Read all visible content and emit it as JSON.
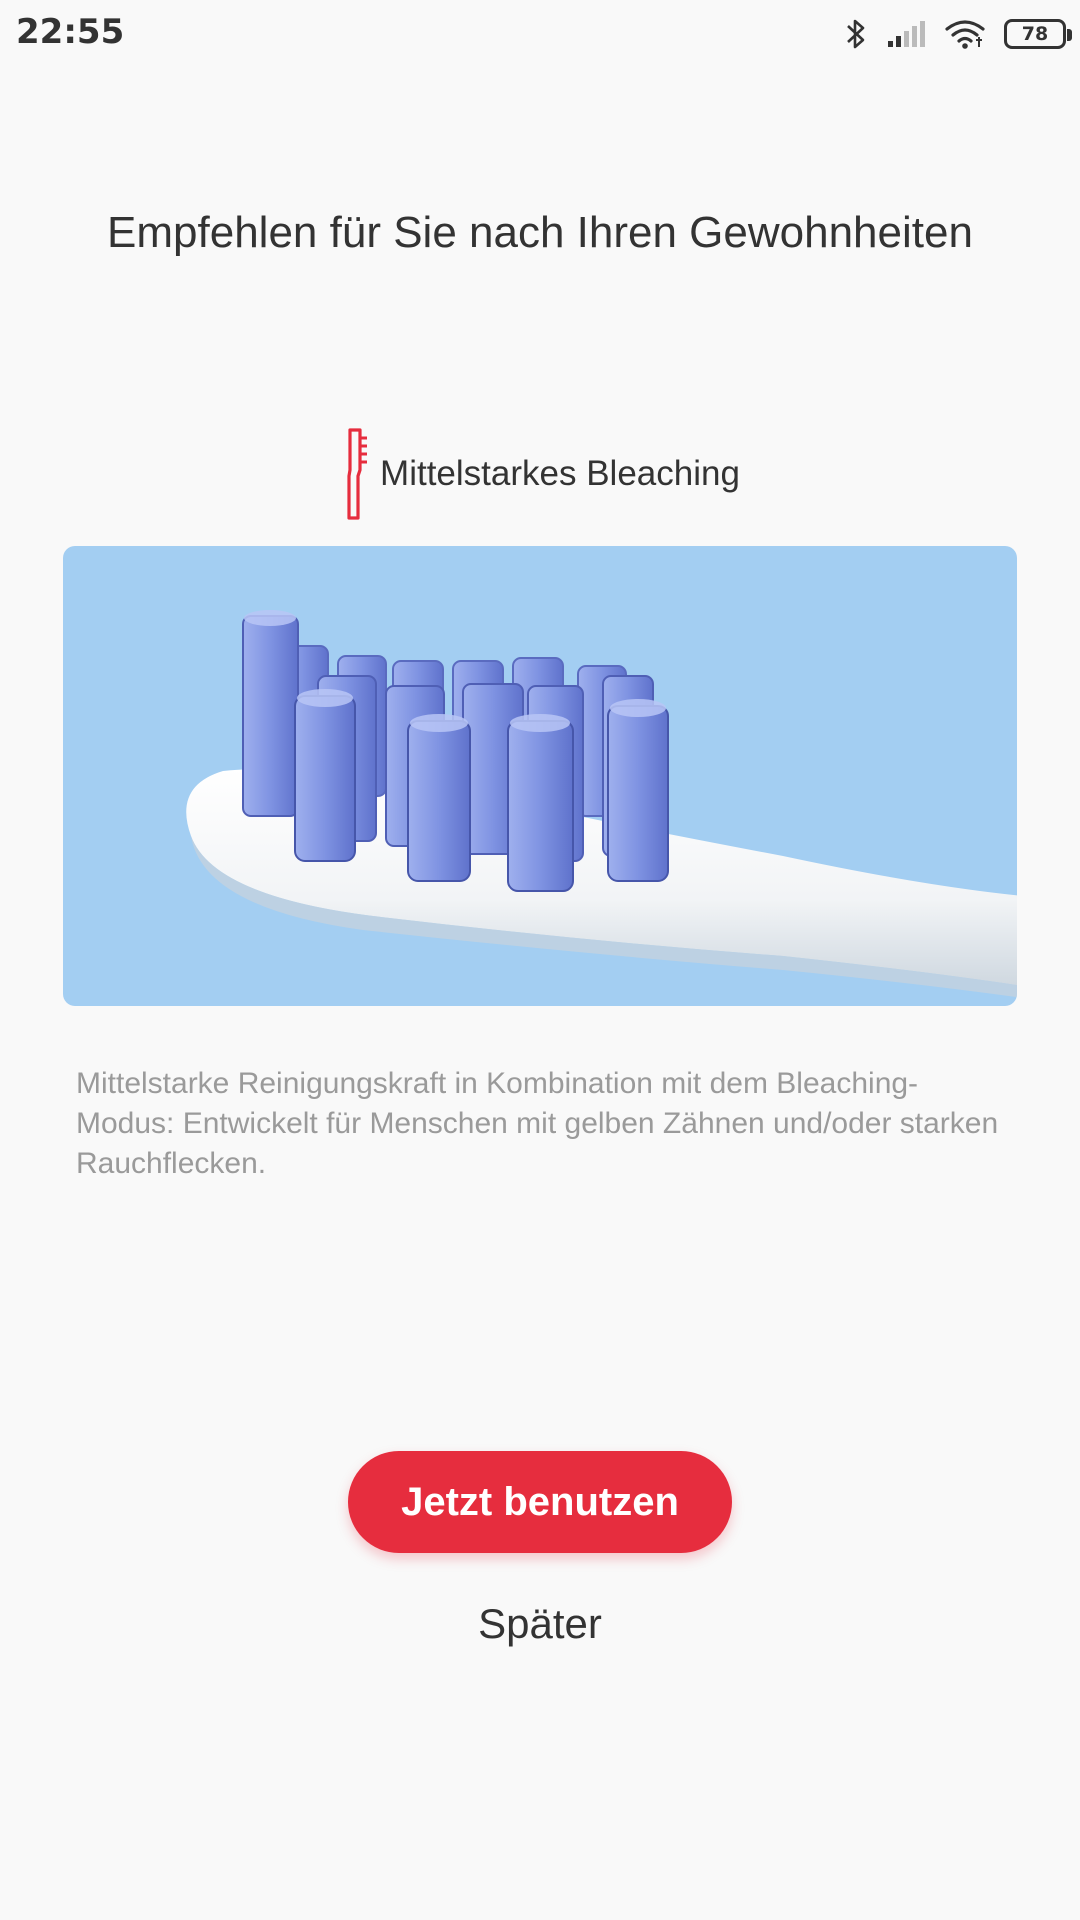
{
  "status_bar": {
    "time": "22:55",
    "battery": "78",
    "icons": [
      "bluetooth-icon",
      "signal-icon",
      "wifi-icon",
      "battery-icon"
    ]
  },
  "title": "Empfehlen für Sie nach Ihren Gewohnheiten",
  "mode": {
    "icon": "toothbrush-icon",
    "name": "Mittelstarkes Bleaching",
    "icon_color": "#e62d3e"
  },
  "hero_image": {
    "subject": "toothbrush-head-illustration",
    "background_color": "#a3cef2"
  },
  "description": "Mittelstarke Reinigungskraft in Kombination mit dem Bleaching-Modus: Entwickelt für Menschen mit gelben Zähnen und/oder starken Rauchflecken.",
  "actions": {
    "primary_label": "Jetzt benutzen",
    "secondary_label": "Später",
    "primary_color": "#e62d3e"
  }
}
